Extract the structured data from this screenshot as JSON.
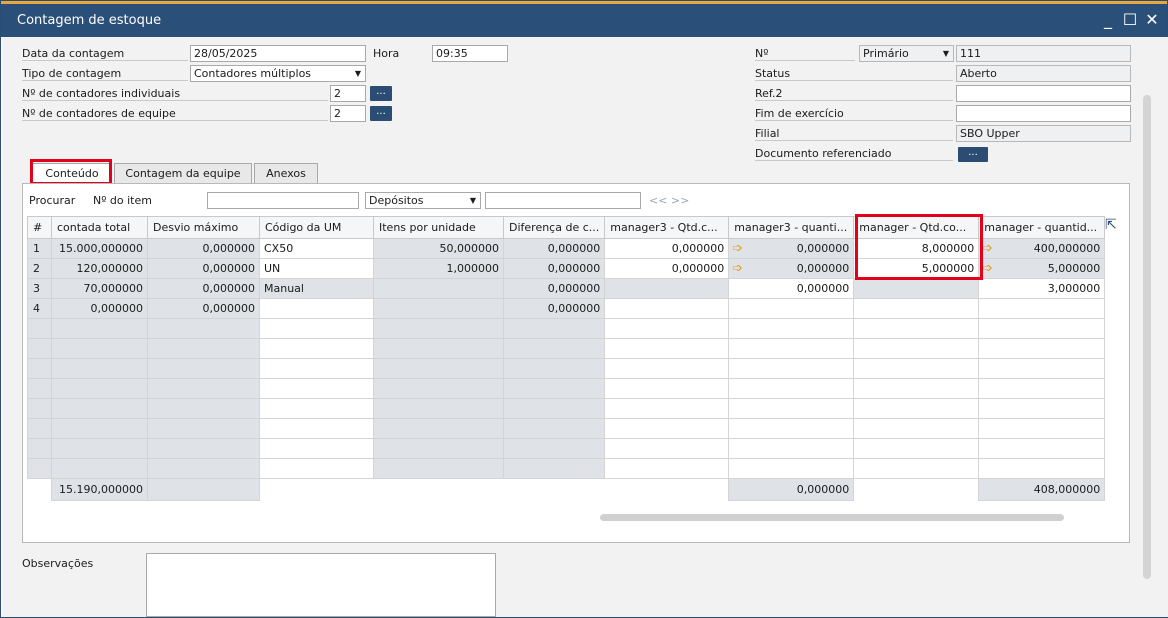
{
  "window": {
    "title": "Contagem de estoque",
    "min": "_",
    "max": "☐",
    "close": "✕"
  },
  "header": {
    "date_label": "Data da contagem",
    "date_value": "28/05/2025",
    "hora_label": "Hora",
    "hora_value": "09:35",
    "tipo_label": "Tipo de contagem",
    "tipo_value": "Contadores múltiplos",
    "ind_label": "Nº de contadores individuais",
    "ind_value": "2",
    "eq_label": "Nº de contadores de equipe",
    "eq_value": "2",
    "ellipsis": "...",
    "no_label": "Nº",
    "no_series": "Primário",
    "no_value": "111",
    "status_label": "Status",
    "status_value": "Aberto",
    "ref2_label": "Ref.2",
    "ref2_value": "",
    "fim_label": "Fim de exercício",
    "fim_value": "",
    "filial_label": "Filial",
    "filial_value": "SBO Upper",
    "docref_label": "Documento referenciado"
  },
  "tabs": [
    {
      "label": "Conteúdo"
    },
    {
      "label": "Contagem da equipe"
    },
    {
      "label": "Anexos"
    }
  ],
  "search": {
    "procurar": "Procurar",
    "item_label": "Nº do item",
    "item_value": "",
    "warehouse": "Depósitos",
    "wh_value": "",
    "nav": "<< >>"
  },
  "grid": {
    "columns": [
      "#",
      "contada total",
      "Desvio máximo",
      "Código da UM",
      "Itens por unidade",
      "Diferença de c...",
      "manager3 - Qtd.c...",
      "manager3 - quanti...",
      "manager - Qtd.co...",
      "manager - quantid..."
    ],
    "rows": [
      [
        "1",
        "15.000,000000",
        "0,000000",
        "CX50",
        "50,000000",
        "0,000000",
        "0,000000",
        "0,000000",
        "8,000000",
        "400,000000"
      ],
      [
        "2",
        "120,000000",
        "0,000000",
        "UN",
        "1,000000",
        "0,000000",
        "0,000000",
        "0,000000",
        "5,000000",
        "5,000000"
      ],
      [
        "3",
        "70,000000",
        "0,000000",
        "Manual",
        "",
        "0,000000",
        "",
        "0,000000",
        "",
        "3,000000"
      ],
      [
        "4",
        "0,000000",
        "0,000000",
        "",
        "",
        "0,000000",
        "",
        "",
        "",
        ""
      ]
    ],
    "totals": {
      "total_contada": "15.190,000000",
      "total_m3": "0,000000",
      "total_m": "408,000000"
    }
  },
  "footer": {
    "obs_label": "Observações",
    "obs_value": ""
  },
  "colors": {
    "titlebar": "#2a4f79",
    "accent": "#e8a63c",
    "highlight": "#e3001b",
    "arrow": "#e39e19"
  }
}
